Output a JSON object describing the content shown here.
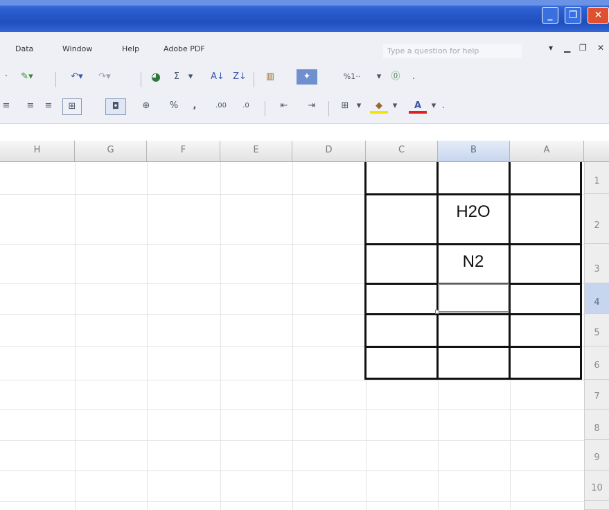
{
  "menu": {
    "items": [
      {
        "label": "Data"
      },
      {
        "label": "Window"
      },
      {
        "label": "Help"
      },
      {
        "label": "Adobe PDF"
      }
    ],
    "help_placeholder": "Type a question for help"
  },
  "toolbar1": {
    "sigma": "Σ",
    "sort_asc": "↓",
    "sort_desc": "↓",
    "zoom": "%1··"
  },
  "toolbar2": {
    "percent": "%",
    "comma": ",",
    "inc_decimal": ".00",
    "dec_decimal": ".0"
  },
  "columns": [
    "H",
    "G",
    "F",
    "E",
    "D",
    "C",
    "B",
    "A"
  ],
  "rows": [
    "1",
    "2",
    "3",
    "4",
    "5",
    "6",
    "7",
    "8",
    "9",
    "10"
  ],
  "cells": {
    "B2": "H2O",
    "B3": "N2"
  },
  "active_cell": {
    "column": "B",
    "row": "4"
  }
}
